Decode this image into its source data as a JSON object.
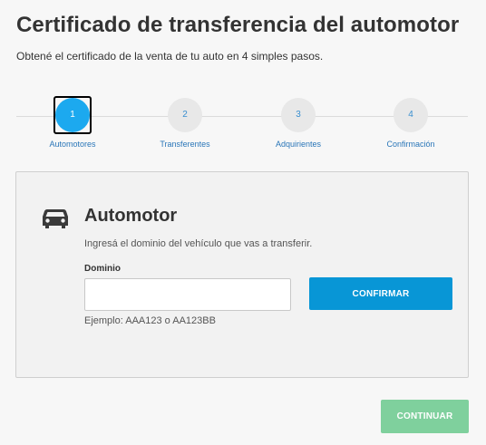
{
  "header": {
    "title": "Certificado de transferencia del automotor",
    "subtitle": "Obtené el certificado de la venta de tu auto en 4 simples pasos."
  },
  "stepper": {
    "steps": [
      {
        "number": "1",
        "label": "Automotores",
        "active": true
      },
      {
        "number": "2",
        "label": "Transferentes",
        "active": false
      },
      {
        "number": "3",
        "label": "Adquirientes",
        "active": false
      },
      {
        "number": "4",
        "label": "Confirmación",
        "active": false
      }
    ]
  },
  "card": {
    "icon": "car-icon",
    "title": "Automotor",
    "description": "Ingresá el dominio del vehículo que vas a transferir.",
    "domain_label": "Dominio",
    "domain_value": "",
    "domain_placeholder": "",
    "hint": "Ejemplo: AAA123 o AA123BB",
    "confirm_label": "CONFIRMAR"
  },
  "footer": {
    "continue_label": "CONTINUAR"
  },
  "colors": {
    "active_step": "#1ca9ef",
    "confirm_button": "#0896d6",
    "continue_button": "#7fd09d",
    "step_label": "#2a76b8"
  }
}
